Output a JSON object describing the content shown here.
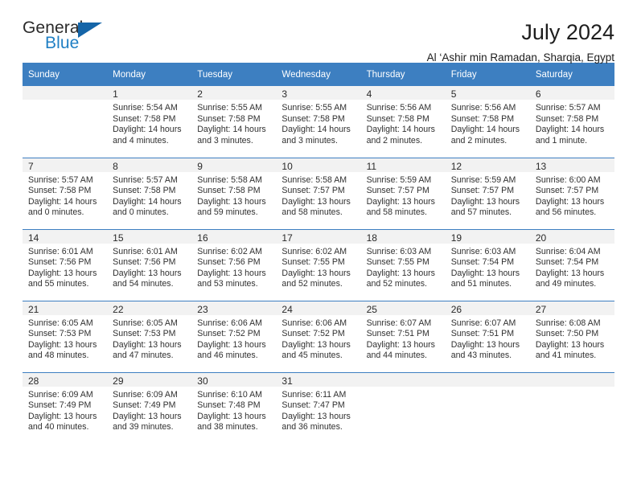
{
  "brand": {
    "name_part1": "General",
    "name_part2": "Blue",
    "triangle_icon": "triangle-icon"
  },
  "header": {
    "title": "July 2024",
    "subtitle": "Al ‘Ashir min Ramadan, Sharqia, Egypt",
    "accent_color": "#3d7fc1",
    "logo_blue_color": "#1f7fc4"
  },
  "weekday_headers": [
    "Sunday",
    "Monday",
    "Tuesday",
    "Wednesday",
    "Thursday",
    "Friday",
    "Saturday"
  ],
  "weeks": [
    [
      {
        "day": "",
        "sunrise": "",
        "sunset": "",
        "daylight1": "",
        "daylight2": ""
      },
      {
        "day": "1",
        "sunrise": "Sunrise: 5:54 AM",
        "sunset": "Sunset: 7:58 PM",
        "daylight1": "Daylight: 14 hours",
        "daylight2": "and 4 minutes."
      },
      {
        "day": "2",
        "sunrise": "Sunrise: 5:55 AM",
        "sunset": "Sunset: 7:58 PM",
        "daylight1": "Daylight: 14 hours",
        "daylight2": "and 3 minutes."
      },
      {
        "day": "3",
        "sunrise": "Sunrise: 5:55 AM",
        "sunset": "Sunset: 7:58 PM",
        "daylight1": "Daylight: 14 hours",
        "daylight2": "and 3 minutes."
      },
      {
        "day": "4",
        "sunrise": "Sunrise: 5:56 AM",
        "sunset": "Sunset: 7:58 PM",
        "daylight1": "Daylight: 14 hours",
        "daylight2": "and 2 minutes."
      },
      {
        "day": "5",
        "sunrise": "Sunrise: 5:56 AM",
        "sunset": "Sunset: 7:58 PM",
        "daylight1": "Daylight: 14 hours",
        "daylight2": "and 2 minutes."
      },
      {
        "day": "6",
        "sunrise": "Sunrise: 5:57 AM",
        "sunset": "Sunset: 7:58 PM",
        "daylight1": "Daylight: 14 hours",
        "daylight2": "and 1 minute."
      }
    ],
    [
      {
        "day": "7",
        "sunrise": "Sunrise: 5:57 AM",
        "sunset": "Sunset: 7:58 PM",
        "daylight1": "Daylight: 14 hours",
        "daylight2": "and 0 minutes."
      },
      {
        "day": "8",
        "sunrise": "Sunrise: 5:57 AM",
        "sunset": "Sunset: 7:58 PM",
        "daylight1": "Daylight: 14 hours",
        "daylight2": "and 0 minutes."
      },
      {
        "day": "9",
        "sunrise": "Sunrise: 5:58 AM",
        "sunset": "Sunset: 7:58 PM",
        "daylight1": "Daylight: 13 hours",
        "daylight2": "and 59 minutes."
      },
      {
        "day": "10",
        "sunrise": "Sunrise: 5:58 AM",
        "sunset": "Sunset: 7:57 PM",
        "daylight1": "Daylight: 13 hours",
        "daylight2": "and 58 minutes."
      },
      {
        "day": "11",
        "sunrise": "Sunrise: 5:59 AM",
        "sunset": "Sunset: 7:57 PM",
        "daylight1": "Daylight: 13 hours",
        "daylight2": "and 58 minutes."
      },
      {
        "day": "12",
        "sunrise": "Sunrise: 5:59 AM",
        "sunset": "Sunset: 7:57 PM",
        "daylight1": "Daylight: 13 hours",
        "daylight2": "and 57 minutes."
      },
      {
        "day": "13",
        "sunrise": "Sunrise: 6:00 AM",
        "sunset": "Sunset: 7:57 PM",
        "daylight1": "Daylight: 13 hours",
        "daylight2": "and 56 minutes."
      }
    ],
    [
      {
        "day": "14",
        "sunrise": "Sunrise: 6:01 AM",
        "sunset": "Sunset: 7:56 PM",
        "daylight1": "Daylight: 13 hours",
        "daylight2": "and 55 minutes."
      },
      {
        "day": "15",
        "sunrise": "Sunrise: 6:01 AM",
        "sunset": "Sunset: 7:56 PM",
        "daylight1": "Daylight: 13 hours",
        "daylight2": "and 54 minutes."
      },
      {
        "day": "16",
        "sunrise": "Sunrise: 6:02 AM",
        "sunset": "Sunset: 7:56 PM",
        "daylight1": "Daylight: 13 hours",
        "daylight2": "and 53 minutes."
      },
      {
        "day": "17",
        "sunrise": "Sunrise: 6:02 AM",
        "sunset": "Sunset: 7:55 PM",
        "daylight1": "Daylight: 13 hours",
        "daylight2": "and 52 minutes."
      },
      {
        "day": "18",
        "sunrise": "Sunrise: 6:03 AM",
        "sunset": "Sunset: 7:55 PM",
        "daylight1": "Daylight: 13 hours",
        "daylight2": "and 52 minutes."
      },
      {
        "day": "19",
        "sunrise": "Sunrise: 6:03 AM",
        "sunset": "Sunset: 7:54 PM",
        "daylight1": "Daylight: 13 hours",
        "daylight2": "and 51 minutes."
      },
      {
        "day": "20",
        "sunrise": "Sunrise: 6:04 AM",
        "sunset": "Sunset: 7:54 PM",
        "daylight1": "Daylight: 13 hours",
        "daylight2": "and 49 minutes."
      }
    ],
    [
      {
        "day": "21",
        "sunrise": "Sunrise: 6:05 AM",
        "sunset": "Sunset: 7:53 PM",
        "daylight1": "Daylight: 13 hours",
        "daylight2": "and 48 minutes."
      },
      {
        "day": "22",
        "sunrise": "Sunrise: 6:05 AM",
        "sunset": "Sunset: 7:53 PM",
        "daylight1": "Daylight: 13 hours",
        "daylight2": "and 47 minutes."
      },
      {
        "day": "23",
        "sunrise": "Sunrise: 6:06 AM",
        "sunset": "Sunset: 7:52 PM",
        "daylight1": "Daylight: 13 hours",
        "daylight2": "and 46 minutes."
      },
      {
        "day": "24",
        "sunrise": "Sunrise: 6:06 AM",
        "sunset": "Sunset: 7:52 PM",
        "daylight1": "Daylight: 13 hours",
        "daylight2": "and 45 minutes."
      },
      {
        "day": "25",
        "sunrise": "Sunrise: 6:07 AM",
        "sunset": "Sunset: 7:51 PM",
        "daylight1": "Daylight: 13 hours",
        "daylight2": "and 44 minutes."
      },
      {
        "day": "26",
        "sunrise": "Sunrise: 6:07 AM",
        "sunset": "Sunset: 7:51 PM",
        "daylight1": "Daylight: 13 hours",
        "daylight2": "and 43 minutes."
      },
      {
        "day": "27",
        "sunrise": "Sunrise: 6:08 AM",
        "sunset": "Sunset: 7:50 PM",
        "daylight1": "Daylight: 13 hours",
        "daylight2": "and 41 minutes."
      }
    ],
    [
      {
        "day": "28",
        "sunrise": "Sunrise: 6:09 AM",
        "sunset": "Sunset: 7:49 PM",
        "daylight1": "Daylight: 13 hours",
        "daylight2": "and 40 minutes."
      },
      {
        "day": "29",
        "sunrise": "Sunrise: 6:09 AM",
        "sunset": "Sunset: 7:49 PM",
        "daylight1": "Daylight: 13 hours",
        "daylight2": "and 39 minutes."
      },
      {
        "day": "30",
        "sunrise": "Sunrise: 6:10 AM",
        "sunset": "Sunset: 7:48 PM",
        "daylight1": "Daylight: 13 hours",
        "daylight2": "and 38 minutes."
      },
      {
        "day": "31",
        "sunrise": "Sunrise: 6:11 AM",
        "sunset": "Sunset: 7:47 PM",
        "daylight1": "Daylight: 13 hours",
        "daylight2": "and 36 minutes."
      },
      {
        "day": "",
        "sunrise": "",
        "sunset": "",
        "daylight1": "",
        "daylight2": ""
      },
      {
        "day": "",
        "sunrise": "",
        "sunset": "",
        "daylight1": "",
        "daylight2": ""
      },
      {
        "day": "",
        "sunrise": "",
        "sunset": "",
        "daylight1": "",
        "daylight2": ""
      }
    ]
  ]
}
